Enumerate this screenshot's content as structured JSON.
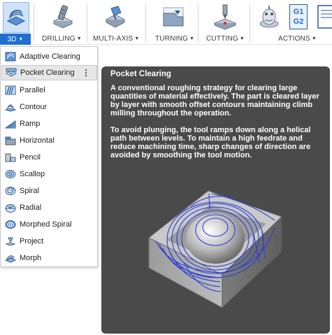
{
  "toolbar": {
    "groups": [
      {
        "label": "3D",
        "icon": "3d-milling-icon"
      },
      {
        "label": "DRILLING",
        "icon": "drill-icon"
      },
      {
        "label": "MULTI-AXIS",
        "icon": "multi-axis-icon"
      },
      {
        "label": "TURNING",
        "icon": "turning-icon"
      },
      {
        "label": "CUTTING",
        "icon": "cutting-icon"
      },
      {
        "label": "ACTIONS",
        "icon": "actions-icon"
      }
    ],
    "g1g2": {
      "line1": "G1",
      "line2": "G2"
    }
  },
  "menu": {
    "items": [
      {
        "label": "Adaptive Clearing",
        "icon": "adaptive-clearing-icon"
      },
      {
        "label": "Pocket Clearing",
        "icon": "pocket-clearing-icon",
        "active": true
      },
      {
        "label": "Parallel",
        "icon": "parallel-icon"
      },
      {
        "label": "Contour",
        "icon": "contour-icon"
      },
      {
        "label": "Ramp",
        "icon": "ramp-icon"
      },
      {
        "label": "Horizontal",
        "icon": "horizontal-icon"
      },
      {
        "label": "Pencil",
        "icon": "pencil-icon"
      },
      {
        "label": "Scallop",
        "icon": "scallop-icon"
      },
      {
        "label": "Spiral",
        "icon": "spiral-icon"
      },
      {
        "label": "Radial",
        "icon": "radial-icon"
      },
      {
        "label": "Morphed Spiral",
        "icon": "morphed-spiral-icon"
      },
      {
        "label": "Project",
        "icon": "project-icon"
      },
      {
        "label": "Morph",
        "icon": "morph-icon"
      }
    ],
    "kebab": "⋮"
  },
  "tooltip": {
    "title": "Pocket Clearing",
    "paragraph1": "A conventional roughing strategy for clearing large quantities of material effectively. The part is cleared layer by layer with smooth offset contours maintaining climb milling throughout the operation.",
    "paragraph2": "To avoid plunging, the tool ramps down along a helical path between levels. To maintain a high feedrate and reduce machining time, sharp changes of direction are avoided by smoothing the tool motion."
  },
  "colors": {
    "accent": "#1f6fd0",
    "tooltip_bg": "#4a4a4a",
    "toolpath": "#2a3fd8"
  }
}
